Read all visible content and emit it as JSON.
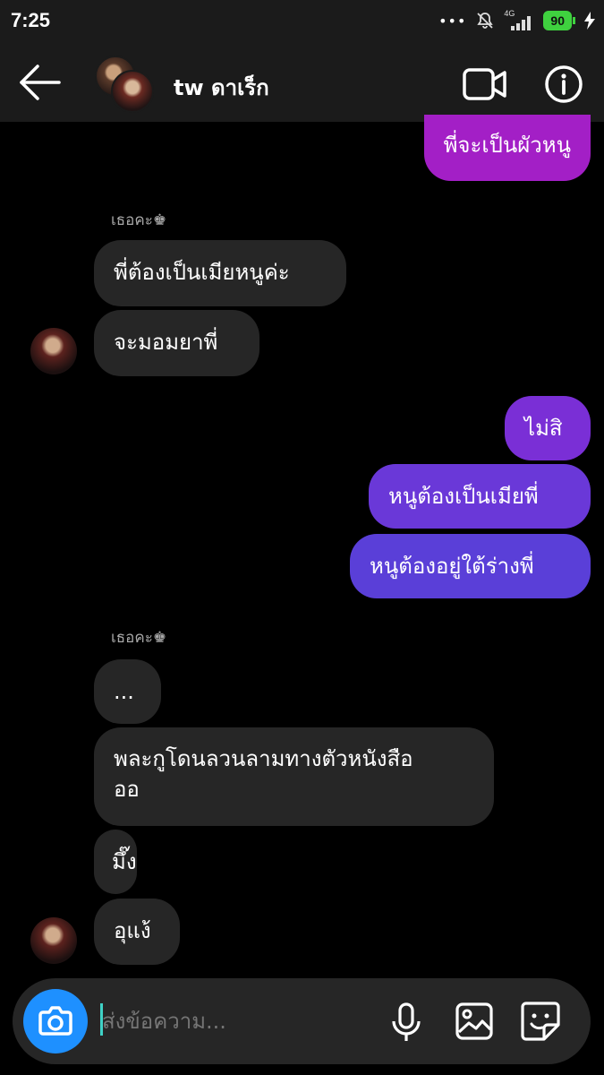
{
  "status_bar": {
    "time": "7:25",
    "dots": "•••",
    "network": "4G",
    "battery": "90",
    "colors": {
      "battery": "#3fd13f"
    }
  },
  "header": {
    "title": "tw ดาเร็ก",
    "icons": [
      "back-arrow-icon",
      "video-call-icon",
      "info-icon"
    ]
  },
  "messages": [
    {
      "side": "out",
      "text": "พี่จะเป็นผัวหนู",
      "color": "#a31fc6"
    },
    {
      "side": "sender",
      "text": "เธอคะ♚"
    },
    {
      "side": "in",
      "text": "พี่ต้องเป็นเมียหนูค่ะ"
    },
    {
      "side": "in",
      "text": "จะมอมยาพี่"
    },
    {
      "side": "out",
      "text": "ไม่สิ",
      "color": "#7a2fd6"
    },
    {
      "side": "out",
      "text": "หนูต้องเป็นเมียพี่",
      "color": "#6a38d8"
    },
    {
      "side": "out",
      "text": "หนูต้องอยู่ใต้ร่างพี่",
      "color": "#5a3fd8"
    },
    {
      "side": "sender",
      "text": "เธอคะ♚"
    },
    {
      "side": "in",
      "text": "..."
    },
    {
      "side": "in",
      "text": "พละกูโดนลวนลามทางตัวหนังสือ",
      "text2": "ออ"
    },
    {
      "side": "in",
      "text": "มึ๊ง"
    },
    {
      "side": "in",
      "text": "อุแง้"
    }
  ],
  "composer": {
    "placeholder": "ส่งข้อความ...",
    "icons": [
      "camera-icon",
      "microphone-icon",
      "image-icon",
      "sticker-icon"
    ],
    "colors": {
      "camera": "#1e90ff"
    }
  }
}
